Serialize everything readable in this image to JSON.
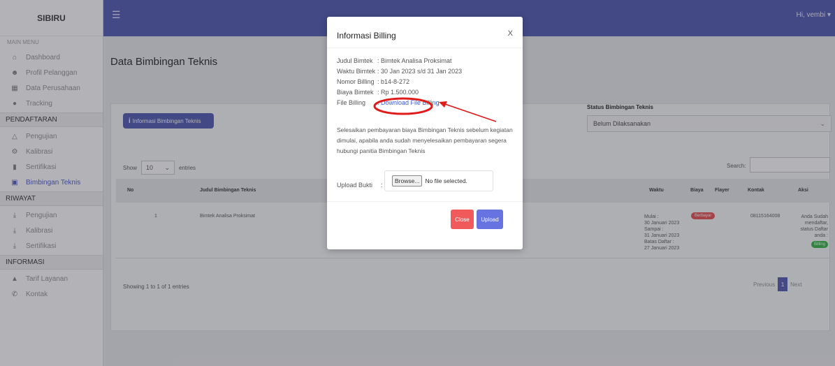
{
  "sidebar": {
    "brand": "SIBIRU",
    "menu_caption": "MAIN MENU",
    "main_items": [
      {
        "label": "Dashboard",
        "icon": "home-icon"
      },
      {
        "label": "Profil Pelanggan",
        "icon": "user-icon"
      },
      {
        "label": "Data Perusahaan",
        "icon": "building-icon"
      },
      {
        "label": "Tracking",
        "icon": "location-pin-icon"
      }
    ],
    "sections": [
      {
        "title": "PENDAFTARAN",
        "items": [
          {
            "label": "Pengujian",
            "icon": "flask-icon"
          },
          {
            "label": "Kalibrasi",
            "icon": "gauge-icon"
          },
          {
            "label": "Sertifikasi",
            "icon": "certificate-icon"
          },
          {
            "label": "Bimbingan Teknis",
            "icon": "briefcase-icon",
            "active": true
          }
        ]
      },
      {
        "title": "RIWAYAT",
        "items": [
          {
            "label": "Pengujian",
            "icon": "download-icon"
          },
          {
            "label": "Kalibrasi",
            "icon": "download-icon"
          },
          {
            "label": "Sertifikasi",
            "icon": "download-icon"
          }
        ]
      },
      {
        "title": "INFORMASI",
        "items": [
          {
            "label": "Tarif Layanan",
            "icon": "tag-icon"
          },
          {
            "label": "Kontak",
            "icon": "phone-icon"
          }
        ]
      }
    ]
  },
  "topbar": {
    "user_greeting": "Hi, vembi"
  },
  "page": {
    "title": "Data Bimbingan Teknis",
    "info_button": "Informasi Bimbingan Teknis",
    "status_label": "Status Bimbingan Teknis",
    "status_value": "Belum Dilaksanakan",
    "show_label": "Show",
    "entries_value": "10",
    "entries_label": "entries",
    "search_label": "Search:",
    "columns": [
      "No",
      "Judul Bimbingan Teknis",
      "Waktu",
      "Biaya",
      "Flayer",
      "Kontak",
      "Aksi"
    ],
    "row": {
      "no": "1",
      "judul": "Bimtek Analisa Proksimat",
      "waktu": [
        "Mulai :",
        "30 Januari 2023",
        "Sampai :",
        "31 Januari 2023",
        "Batas Daftar :",
        "27 Januari 2023"
      ],
      "biaya_badge": "Berbayar",
      "kontak": "08115164008",
      "aksi_text": [
        "Anda Sudah",
        "mendaftar,",
        "status Daftar",
        "anda :"
      ],
      "aksi_badge": "Billing"
    },
    "showing": "Showing 1 to 1 of 1 entries",
    "pager": {
      "prev": "Previous",
      "current": "1",
      "next": "Next"
    }
  },
  "modal": {
    "title": "Informasi Billing",
    "close_x": "X",
    "fields": [
      {
        "key": "Judul Bimtek",
        "value": ": Bimtek Analisa Proksimat"
      },
      {
        "key": "Waktu Bimtek",
        "value": ": 30 Jan 2023 s/d 31 Jan 2023"
      },
      {
        "key": "Nomor Billing",
        "value": ": b14-8-272"
      },
      {
        "key": "Biaya Bimtek",
        "value": ": Rp 1.500.000"
      },
      {
        "key": "File Billing",
        "value": ":"
      }
    ],
    "download_link": "Download File Billing",
    "message": "Selesaikan pembayaran biaya Bimbingan Teknis sebelum kegiatan dimulai, apabila anda sudah menyelesaikan pembayaran segera hubungi panitia Bimbingan Teknis",
    "upload_label": "Upload Bukti",
    "upload_colon": ":",
    "browse_label": "Browse...",
    "no_file": "No file selected.",
    "close_button": "Close",
    "upload_button": "Upload"
  },
  "colors": {
    "primary": "#5b63b5",
    "annotation_red": "#e01b1b",
    "close_btn": "#f05a5a",
    "upload_btn": "#6673e0"
  }
}
